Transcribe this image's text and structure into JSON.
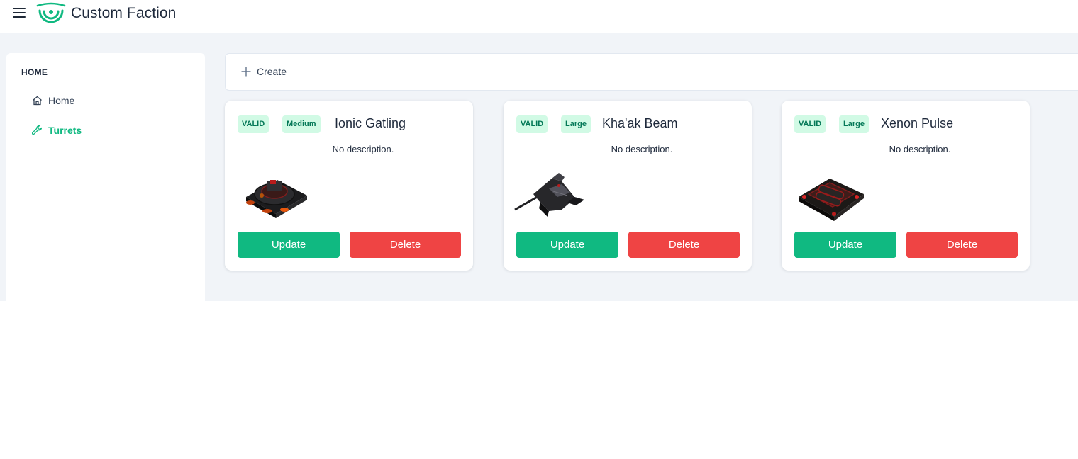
{
  "app": {
    "title": "Custom Faction"
  },
  "icons": {
    "menu": "hamburger-menu-icon",
    "logo": "custom-faction-logo",
    "home": "home-icon",
    "turrets": "wrench-icon",
    "create": "plus-icon"
  },
  "colors": {
    "accent": "#10b981",
    "danger": "#ef4444",
    "badge_bg": "#d1fae5",
    "badge_text": "#047857"
  },
  "sidebar": {
    "heading": "HOME",
    "items": [
      {
        "label": "Home",
        "active": false
      },
      {
        "label": "Turrets",
        "active": true
      }
    ]
  },
  "toolbar": {
    "create_label": "Create"
  },
  "cards": [
    {
      "status": "VALID",
      "size": "Medium",
      "name": "Ionic Gatling",
      "description": "No description.",
      "update_label": "Update",
      "delete_label": "Delete"
    },
    {
      "status": "VALID",
      "size": "Large",
      "name": "Kha'ak Beam",
      "description": "No description.",
      "update_label": "Update",
      "delete_label": "Delete"
    },
    {
      "status": "VALID",
      "size": "Large",
      "name": "Xenon Pulse",
      "description": "No description.",
      "update_label": "Update",
      "delete_label": "Delete"
    }
  ]
}
